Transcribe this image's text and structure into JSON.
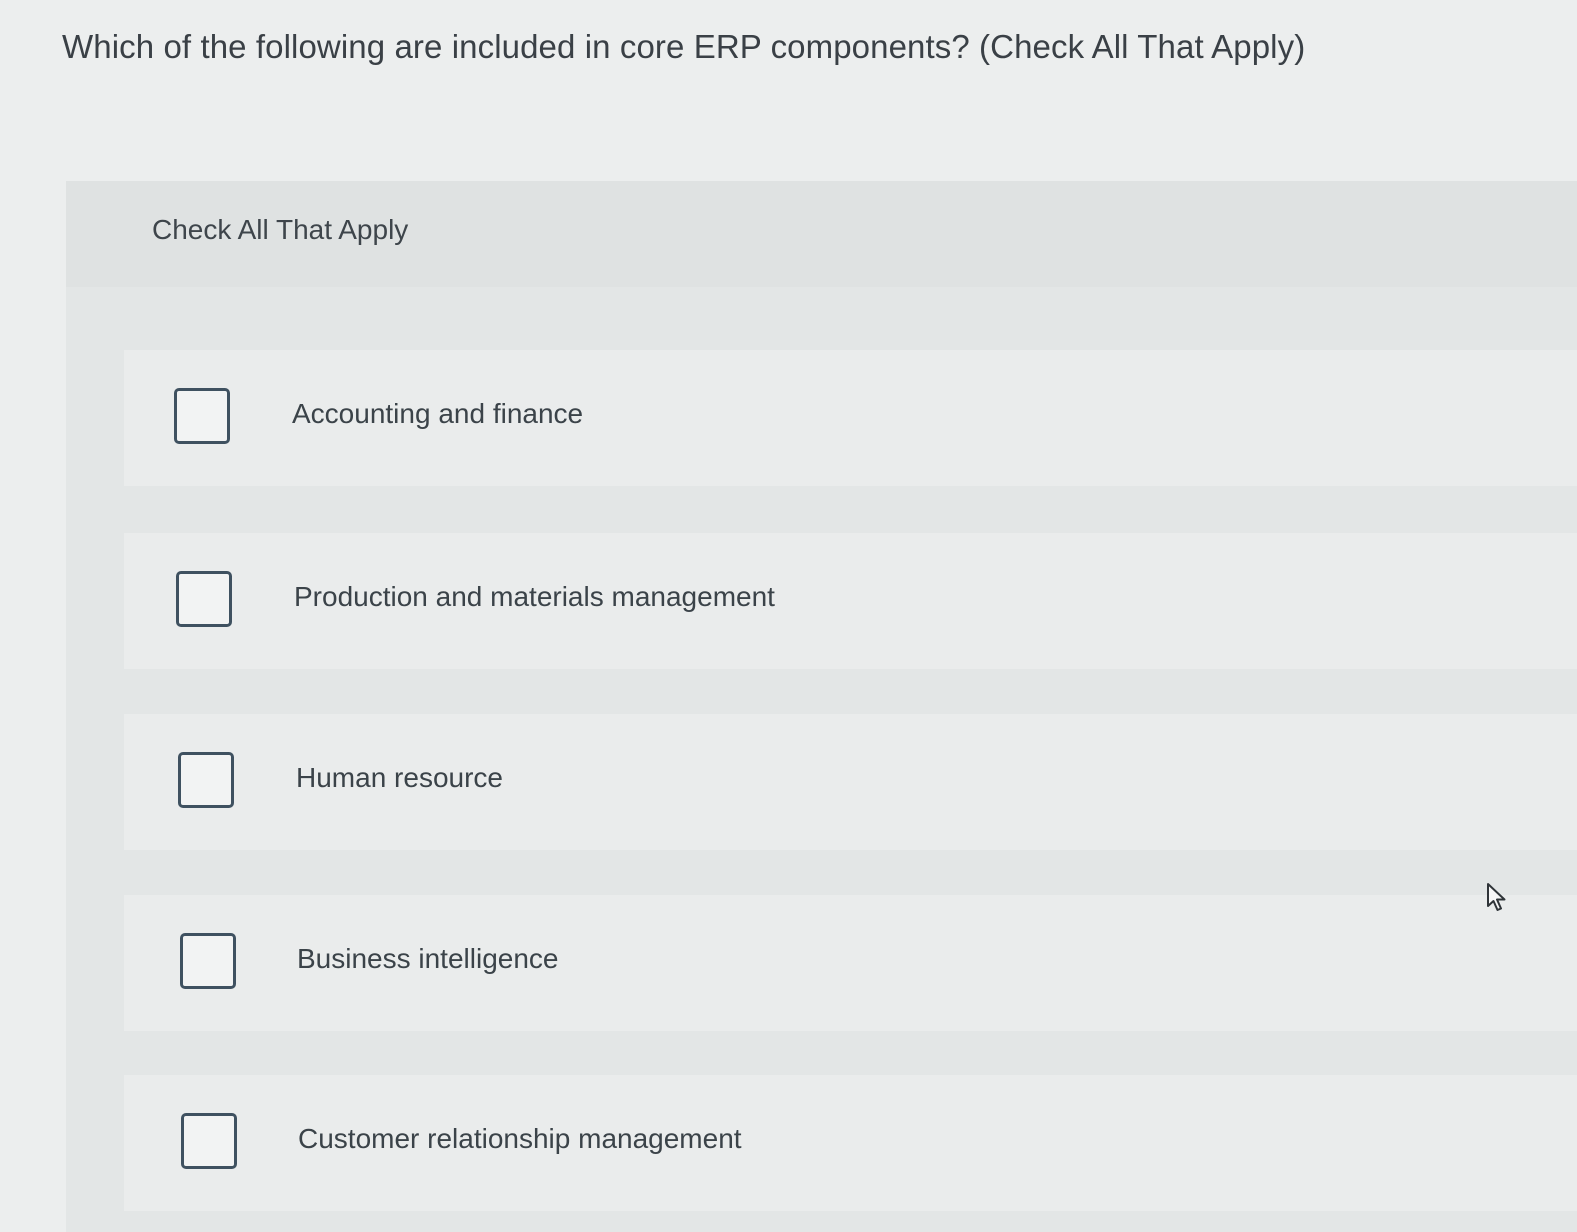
{
  "question": {
    "text": "Which of the following are included in core ERP components? (Check All That Apply)"
  },
  "panel": {
    "label": "Check All That Apply"
  },
  "options": [
    {
      "label": "Accounting and finance",
      "checked": false
    },
    {
      "label": "Production and materials management",
      "checked": false
    },
    {
      "label": "Human resource",
      "checked": false
    },
    {
      "label": "Business intelligence",
      "checked": false
    },
    {
      "label": "Customer relationship management",
      "checked": false
    }
  ],
  "icons": {
    "checkbox": "empty-checkbox-icon",
    "cursor": "mouse-pointer-icon"
  },
  "colors": {
    "checkbox_border": "#3f5160",
    "background": "#eceeee",
    "panel": "#e3e6e6"
  }
}
